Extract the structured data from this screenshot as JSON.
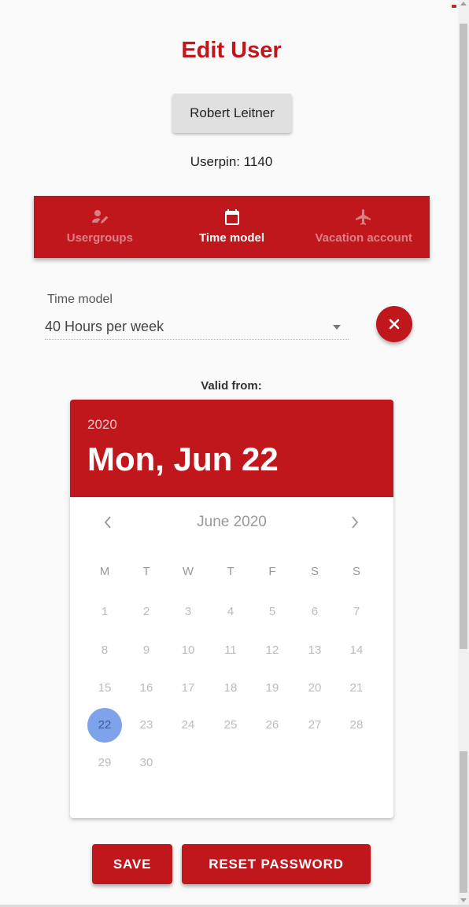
{
  "page": {
    "title": "Edit User"
  },
  "user": {
    "name": "Robert Leitner",
    "userpin": "Userpin: 1140"
  },
  "tabs": [
    {
      "label": "Usergroups",
      "icon": "user-group-icon",
      "active": false
    },
    {
      "label": "Time model",
      "icon": "calendar-icon",
      "active": true
    },
    {
      "label": "Vacation account",
      "icon": "airplane-icon",
      "active": false
    }
  ],
  "time_model": {
    "label": "Time model",
    "value": "40 Hours per week",
    "clear_icon": "close-icon"
  },
  "valid_from": {
    "label": "Valid from:",
    "year": "2020",
    "selected_date": "Mon, Jun 22",
    "month_label": "June 2020",
    "weekdays": [
      "M",
      "T",
      "W",
      "T",
      "F",
      "S",
      "S"
    ],
    "days": [
      "1",
      "2",
      "3",
      "4",
      "5",
      "6",
      "7",
      "8",
      "9",
      "10",
      "11",
      "12",
      "13",
      "14",
      "15",
      "16",
      "17",
      "18",
      "19",
      "20",
      "21",
      "22",
      "23",
      "24",
      "25",
      "26",
      "27",
      "28",
      "29",
      "30"
    ],
    "first_weekday_index": 0,
    "selected_day": "22"
  },
  "actions": {
    "save": "SAVE",
    "reset_password": "RESET PASSWORD"
  },
  "colors": {
    "primary": "#c0171d",
    "selected_day": "#7ea3eb"
  }
}
